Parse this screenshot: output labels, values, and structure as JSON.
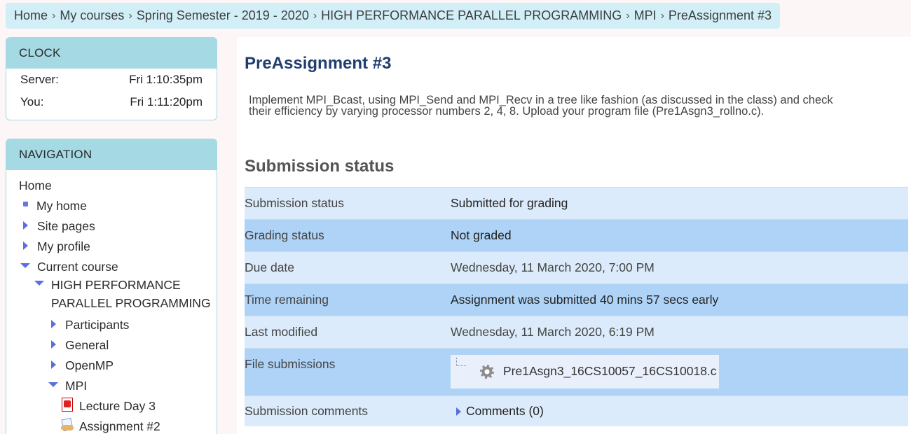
{
  "breadcrumb": [
    "Home",
    "My courses",
    "Spring Semester - 2019 - 2020",
    "HIGH PERFORMANCE PARALLEL PROGRAMMING",
    "MPI",
    "PreAssignment #3"
  ],
  "clock": {
    "title": "CLOCK",
    "server_label": "Server:",
    "server_time": "Fri 1:10:35pm",
    "you_label": "You:",
    "you_time": "Fri 1:11:20pm"
  },
  "navigation": {
    "title": "NAVIGATION",
    "home": "Home",
    "my_home": "My home",
    "site_pages": "Site pages",
    "my_profile": "My profile",
    "current_course": "Current course",
    "course_line1": "HIGH PERFORMANCE",
    "course_line2": "PARALLEL PROGRAMMING",
    "participants": "Participants",
    "general": "General",
    "openmp": "OpenMP",
    "mpi": "MPI",
    "lecture_day3": "Lecture Day 3",
    "assignment2": "Assignment #2"
  },
  "main": {
    "title": "PreAssignment #3",
    "intro_line1": "Implement MPI_Bcast, using MPI_Send and MPI_Recv in a tree like fashion (as discussed in the class) and check",
    "intro_line2": "their efficiency by varying processor numbers 2, 4, 8. Upload your program file (Pre1Asgn3_rollno.c).",
    "section_title": "Submission status",
    "rows": [
      {
        "label": "Submission status",
        "value": "Submitted for grading"
      },
      {
        "label": "Grading status",
        "value": "Not graded"
      },
      {
        "label": "Due date",
        "value": "Wednesday, 11 March 2020, 7:00 PM"
      },
      {
        "label": "Time remaining",
        "value": "Assignment was submitted 40 mins 57 secs early"
      },
      {
        "label": "Last modified",
        "value": "Wednesday, 11 March 2020, 6:19 PM"
      },
      {
        "label": "File submissions",
        "value": "Pre1Asgn3_16CS10057_16CS10018.c"
      },
      {
        "label": "Submission comments",
        "value": "Comments (0)"
      }
    ]
  },
  "colors": {
    "accent": "#5b6fe0",
    "block_header": "#a5d9e4",
    "row_light": "#dcebfb",
    "row_dark": "#aed3f6",
    "title": "#1f3e6e"
  }
}
